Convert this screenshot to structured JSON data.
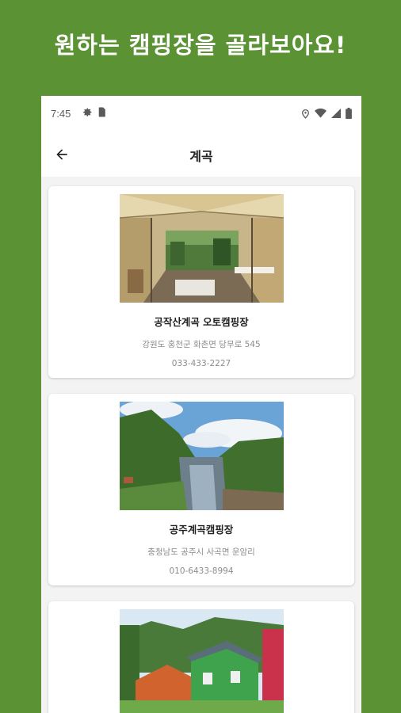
{
  "headline": "원하는 캠핑장을 골라보아요!",
  "status_bar": {
    "time": "7:45"
  },
  "app_bar": {
    "title": "계곡"
  },
  "icons": {
    "back": "arrow-left-icon",
    "settings": "gear-icon",
    "sim": "sim-card-icon",
    "location": "location-icon",
    "wifi": "wifi-icon",
    "signal": "signal-icon",
    "battery": "battery-icon"
  },
  "colors": {
    "background": "#5b9334",
    "card": "#ffffff",
    "screen": "#f3f3f3"
  },
  "campsites": [
    {
      "name": "공작산계곡 오토캠핑장",
      "address": "강원도 홍천군 화촌면 당무로 545",
      "phone": "033-433-2227"
    },
    {
      "name": "공주계곡캠핑장",
      "address": "충청남도 공주시 사곡면 운암리",
      "phone": "010-6433-8994"
    },
    {
      "name": "",
      "address": "",
      "phone": ""
    }
  ]
}
